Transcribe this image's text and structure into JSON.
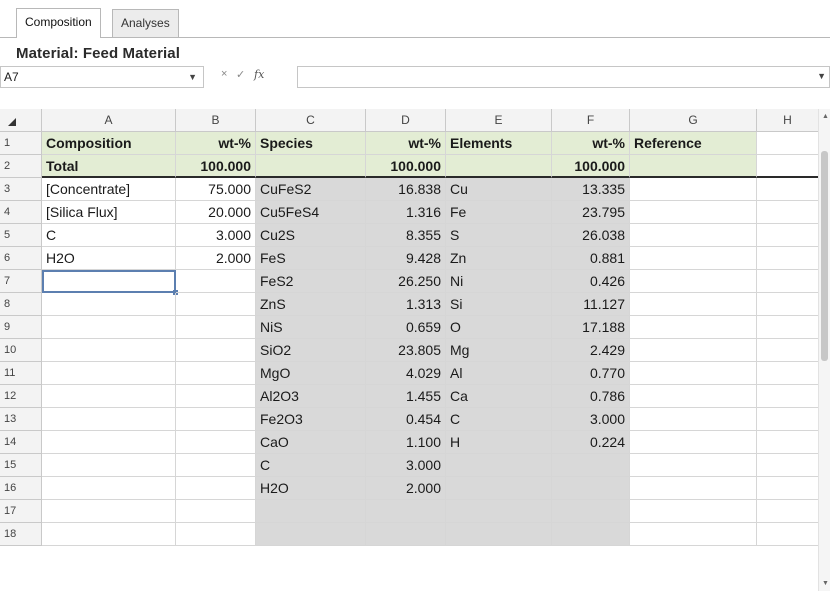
{
  "tabs": [
    {
      "label": "Composition",
      "active": true
    },
    {
      "label": "Analyses",
      "active": false
    }
  ],
  "title": "Material: Feed Material",
  "formula_bar": {
    "name_box": "A7",
    "cancel_glyph": "×",
    "enter_glyph": "✓",
    "fx_glyph": "fx",
    "formula_value": ""
  },
  "grid": {
    "column_headers": [
      "A",
      "B",
      "C",
      "D",
      "E",
      "F",
      "G",
      "H"
    ],
    "rows": [
      {
        "n": "1",
        "cells": [
          "Composition",
          "wt-%",
          "Species",
          "wt-%",
          "Elements",
          "wt-%",
          "Reference",
          ""
        ]
      },
      {
        "n": "2",
        "cells": [
          "Total",
          "100.000",
          "",
          "100.000",
          "",
          "100.000",
          "",
          ""
        ]
      },
      {
        "n": "3",
        "cells": [
          "[Concentrate]",
          "75.000",
          "CuFeS2",
          "16.838",
          "Cu",
          "13.335",
          "",
          ""
        ]
      },
      {
        "n": "4",
        "cells": [
          "[Silica Flux]",
          "20.000",
          "Cu5FeS4",
          "1.316",
          "Fe",
          "23.795",
          "",
          ""
        ]
      },
      {
        "n": "5",
        "cells": [
          "C",
          "3.000",
          "Cu2S",
          "8.355",
          "S",
          "26.038",
          "",
          ""
        ]
      },
      {
        "n": "6",
        "cells": [
          "H2O",
          "2.000",
          "FeS",
          "9.428",
          "Zn",
          "0.881",
          "",
          ""
        ]
      },
      {
        "n": "7",
        "cells": [
          "",
          "",
          "FeS2",
          "26.250",
          "Ni",
          "0.426",
          "",
          ""
        ]
      },
      {
        "n": "8",
        "cells": [
          "",
          "",
          "ZnS",
          "1.313",
          "Si",
          "11.127",
          "",
          ""
        ]
      },
      {
        "n": "9",
        "cells": [
          "",
          "",
          "NiS",
          "0.659",
          "O",
          "17.188",
          "",
          ""
        ]
      },
      {
        "n": "10",
        "cells": [
          "",
          "",
          "SiO2",
          "23.805",
          "Mg",
          "2.429",
          "",
          ""
        ]
      },
      {
        "n": "11",
        "cells": [
          "",
          "",
          "MgO",
          "4.029",
          "Al",
          "0.770",
          "",
          ""
        ]
      },
      {
        "n": "12",
        "cells": [
          "",
          "",
          "Al2O3",
          "1.455",
          "Ca",
          "0.786",
          "",
          ""
        ]
      },
      {
        "n": "13",
        "cells": [
          "",
          "",
          "Fe2O3",
          "0.454",
          "C",
          "3.000",
          "",
          ""
        ]
      },
      {
        "n": "14",
        "cells": [
          "",
          "",
          "CaO",
          "1.100",
          "H",
          "0.224",
          "",
          ""
        ]
      },
      {
        "n": "15",
        "cells": [
          "",
          "",
          "C",
          "3.000",
          "",
          "",
          "",
          ""
        ]
      },
      {
        "n": "16",
        "cells": [
          "",
          "",
          "H2O",
          "2.000",
          "",
          "",
          "",
          ""
        ]
      },
      {
        "n": "17",
        "cells": [
          "",
          "",
          "",
          "",
          "",
          "",
          "",
          ""
        ]
      },
      {
        "n": "18",
        "cells": [
          "",
          "",
          "",
          "",
          "",
          "",
          "",
          ""
        ]
      }
    ],
    "selected_cell": "A7"
  },
  "colors": {
    "header_row_fill": "#e3edd4",
    "species_elements_fill": "#d9d9d9",
    "selection": "#5c7fb0"
  }
}
